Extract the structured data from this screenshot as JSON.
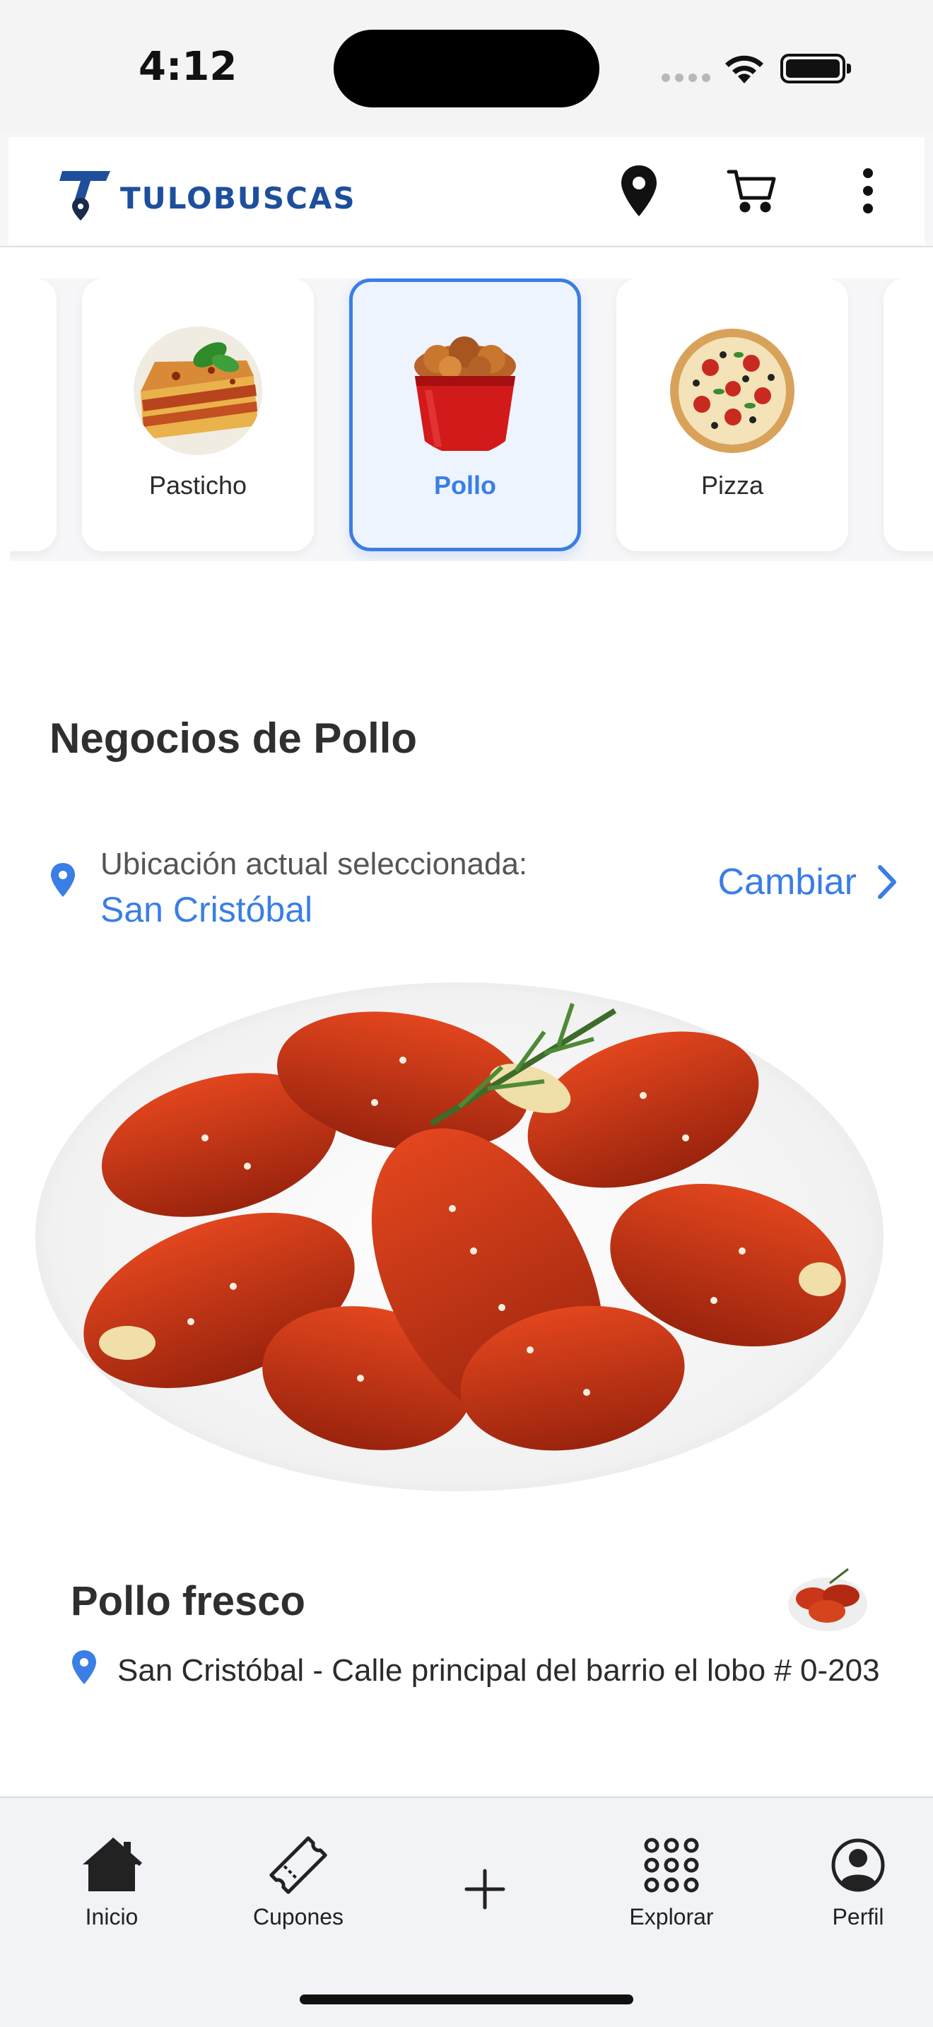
{
  "status_bar": {
    "time": "4:12"
  },
  "header": {
    "logo_text": "TULOBUSCAS",
    "icons": [
      "location-pin-icon",
      "cart-icon",
      "more-vertical-icon"
    ]
  },
  "categories": [
    {
      "label": "Pasticho",
      "selected": false
    },
    {
      "label": "Pollo",
      "selected": true
    },
    {
      "label": "Pizza",
      "selected": false
    }
  ],
  "section": {
    "title": "Negocios de Pollo"
  },
  "location": {
    "label": "Ubicación actual seleccionada:",
    "value": "San Cristóbal",
    "change_label": "Cambiar"
  },
  "business": {
    "name": "Pollo fresco",
    "address": "San Cristóbal - Calle principal del barrio el lobo # 0-203"
  },
  "tabs": [
    {
      "label": "Inicio",
      "icon": "home-icon"
    },
    {
      "label": "Cupones",
      "icon": "ticket-icon"
    },
    {
      "label": "",
      "icon": "plus-icon"
    },
    {
      "label": "Explorar",
      "icon": "grid-dots-icon"
    },
    {
      "label": "Perfil",
      "icon": "user-circle-icon"
    }
  ],
  "colors": {
    "accent": "#3a7ee6",
    "brand": "#1d4f9c",
    "selected_bg": "#eef4fe"
  }
}
